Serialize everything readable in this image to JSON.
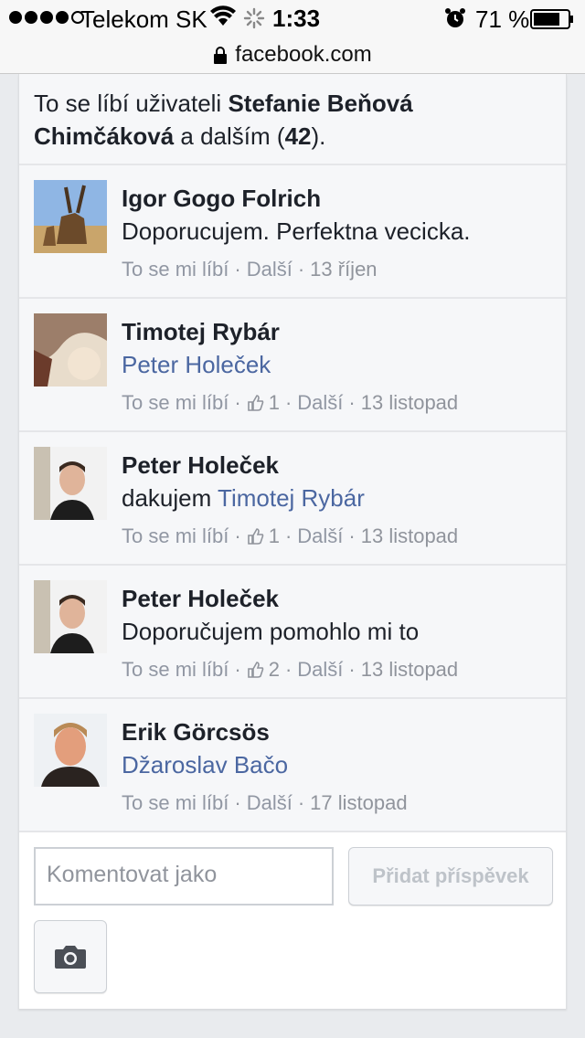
{
  "status": {
    "carrier": "Telekom SK",
    "time": "1:33",
    "battery": "71 %"
  },
  "browser": {
    "url": "facebook.com"
  },
  "likes": {
    "prefix": "To se líbí uživateli ",
    "name": "Stefanie Beňová Chimčáková",
    "middle": " a dalším (",
    "count": "42",
    "suffix": ")."
  },
  "comments": [
    {
      "author": "Igor Gogo Folrich",
      "text": "Doporucujem. Perfektna vecicka.",
      "mention": "",
      "like_label": "To se mi líbí",
      "like_count": "",
      "more_label": "Další",
      "date": "13 říjen"
    },
    {
      "author": "Timotej Rybár",
      "text": "",
      "mention": "Peter Holeček",
      "like_label": "To se mi líbí",
      "like_count": "1",
      "more_label": "Další",
      "date": "13 listopad"
    },
    {
      "author": "Peter Holeček",
      "text": "dakujem ",
      "mention": "Timotej Rybár",
      "like_label": "To se mi líbí",
      "like_count": "1",
      "more_label": "Další",
      "date": "13 listopad"
    },
    {
      "author": "Peter Holeček",
      "text": "Doporučujem pomohlo mi to",
      "mention": "",
      "like_label": "To se mi líbí",
      "like_count": "2",
      "more_label": "Další",
      "date": "13 listopad"
    },
    {
      "author": "Erik Görcsös",
      "text": "",
      "mention": "Džaroslav Bačo",
      "like_label": "To se mi líbí",
      "like_count": "",
      "more_label": "Další",
      "date": "17 listopad"
    }
  ],
  "compose": {
    "placeholder": "Komentovat jako",
    "post_label": "Přidat příspěvek"
  },
  "colors": {
    "link": "#4b67a1",
    "meta": "#90949c",
    "background": "#e9ebee"
  }
}
